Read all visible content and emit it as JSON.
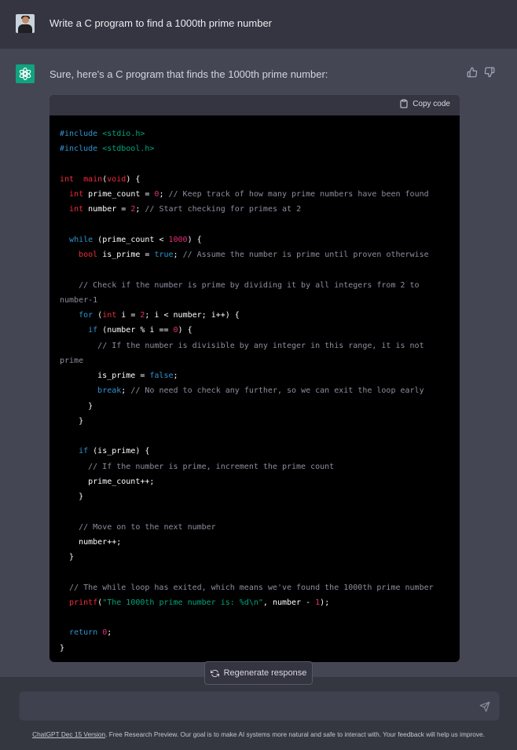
{
  "user_message": "Write a C program to find a 1000th prime number",
  "assistant": {
    "intro": "Sure, here's a C program that finds the 1000th prime number:",
    "copy_label": "Copy code",
    "code_lines": [
      [
        [
          "pre",
          "#include "
        ],
        [
          "inc",
          "<stdio.h>"
        ]
      ],
      [
        [
          "pre",
          "#include "
        ],
        [
          "inc",
          "<stdbool.h>"
        ]
      ],
      [],
      [
        [
          "type",
          "int"
        ],
        [
          "",
          "  "
        ],
        [
          "fn",
          "main"
        ],
        [
          "",
          "("
        ],
        [
          "type",
          "void"
        ],
        [
          "",
          ") {"
        ]
      ],
      [
        [
          "",
          "  "
        ],
        [
          "type",
          "int"
        ],
        [
          "",
          " prime_count = "
        ],
        [
          "num",
          "0"
        ],
        [
          "",
          "; "
        ],
        [
          "com",
          "// Keep track of how many prime numbers have been found"
        ]
      ],
      [
        [
          "",
          "  "
        ],
        [
          "type",
          "int"
        ],
        [
          "",
          " number = "
        ],
        [
          "num",
          "2"
        ],
        [
          "",
          "; "
        ],
        [
          "com",
          "// Start checking for primes at 2"
        ]
      ],
      [],
      [
        [
          "",
          "  "
        ],
        [
          "kw",
          "while"
        ],
        [
          "",
          " (prime_count < "
        ],
        [
          "num",
          "1000"
        ],
        [
          "",
          ") {"
        ]
      ],
      [
        [
          "",
          "    "
        ],
        [
          "type",
          "bool"
        ],
        [
          "",
          " is_prime = "
        ],
        [
          "kw",
          "true"
        ],
        [
          "",
          "; "
        ],
        [
          "com",
          "// Assume the number is prime until proven otherwise"
        ]
      ],
      [],
      [
        [
          "",
          "    "
        ],
        [
          "com",
          "// Check if the number is prime by dividing it by all integers from 2 to"
        ]
      ],
      [
        [
          "com",
          "number-1"
        ]
      ],
      [
        [
          "",
          "    "
        ],
        [
          "kw",
          "for"
        ],
        [
          "",
          " ("
        ],
        [
          "type",
          "int"
        ],
        [
          "",
          " i = "
        ],
        [
          "num",
          "2"
        ],
        [
          "",
          "; i < number; i++) {"
        ]
      ],
      [
        [
          "",
          "      "
        ],
        [
          "kw",
          "if"
        ],
        [
          "",
          " (number % i == "
        ],
        [
          "num",
          "0"
        ],
        [
          "",
          ") {"
        ]
      ],
      [
        [
          "",
          "        "
        ],
        [
          "com",
          "// If the number is divisible by any integer in this range, it is not"
        ]
      ],
      [
        [
          "com",
          "prime"
        ]
      ],
      [
        [
          "",
          "        is_prime = "
        ],
        [
          "kw",
          "false"
        ],
        [
          "",
          ";"
        ]
      ],
      [
        [
          "",
          "        "
        ],
        [
          "kw",
          "break"
        ],
        [
          "",
          "; "
        ],
        [
          "com",
          "// No need to check any further, so we can exit the loop early"
        ]
      ],
      [
        [
          "",
          "      }"
        ]
      ],
      [
        [
          "",
          "    }"
        ]
      ],
      [],
      [
        [
          "",
          "    "
        ],
        [
          "kw",
          "if"
        ],
        [
          "",
          " (is_prime) {"
        ]
      ],
      [
        [
          "",
          "      "
        ],
        [
          "com",
          "// If the number is prime, increment the prime count"
        ]
      ],
      [
        [
          "",
          "      prime_count++;"
        ]
      ],
      [
        [
          "",
          "    }"
        ]
      ],
      [],
      [
        [
          "",
          "    "
        ],
        [
          "com",
          "// Move on to the next number"
        ]
      ],
      [
        [
          "",
          "    number++;"
        ]
      ],
      [
        [
          "",
          "  }"
        ]
      ],
      [],
      [
        [
          "",
          "  "
        ],
        [
          "com",
          "// The while loop has exited, which means we've found the 1000th prime number"
        ]
      ],
      [
        [
          "",
          "  "
        ],
        [
          "fn",
          "printf"
        ],
        [
          "",
          "("
        ],
        [
          "str",
          "\"The 1000th prime number is: %d\\n\""
        ],
        [
          "",
          ", number - "
        ],
        [
          "num",
          "1"
        ],
        [
          "",
          ");"
        ]
      ],
      [],
      [
        [
          "",
          "  "
        ],
        [
          "kw",
          "return"
        ],
        [
          "",
          " "
        ],
        [
          "num",
          "0"
        ],
        [
          "",
          ";"
        ]
      ],
      [
        [
          "",
          "}"
        ]
      ]
    ]
  },
  "regenerate_label": "Regenerate response",
  "input": {
    "placeholder": ""
  },
  "footer": {
    "link_text": "ChatGPT Dec 15 Version",
    "text": ". Free Research Preview. Our goal is to make AI systems more natural and safe to interact with. Your feedback will help us improve."
  },
  "icons": [
    "user-avatar",
    "chatgpt-logo-icon",
    "thumbs-up-icon",
    "thumbs-down-icon",
    "clipboard-icon",
    "refresh-icon",
    "send-icon"
  ],
  "colors": {
    "brand": "#10a37f",
    "assistant_bg": "#444654",
    "user_bg": "#343541",
    "code_bg": "#000000"
  }
}
